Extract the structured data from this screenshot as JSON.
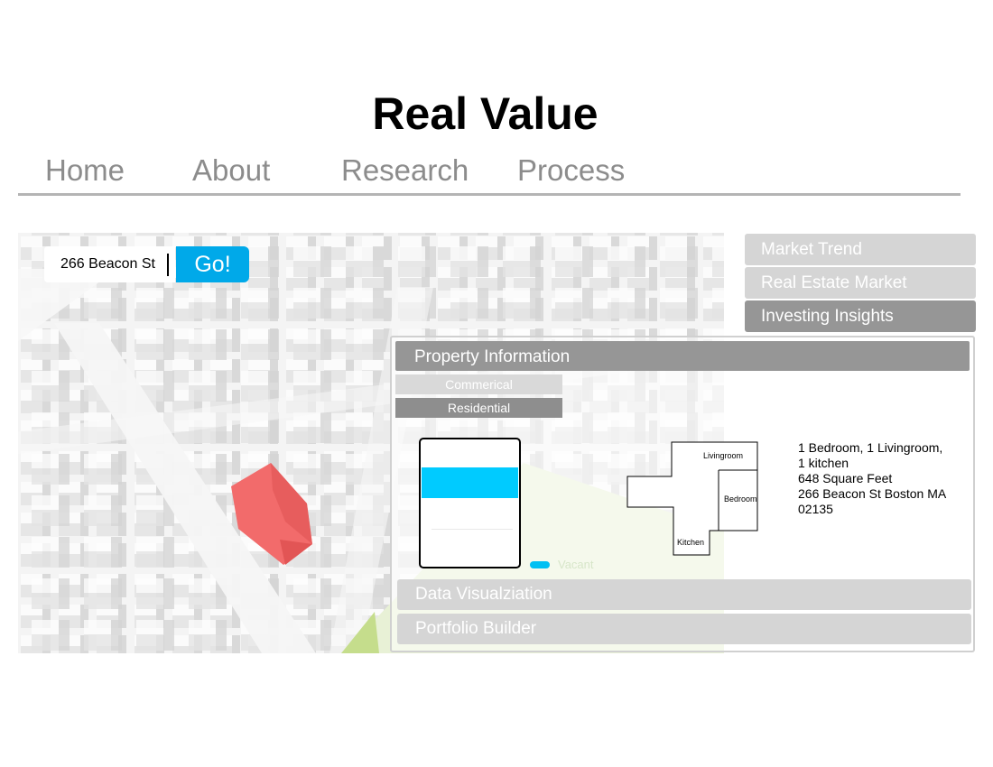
{
  "app": {
    "title": "Real Value"
  },
  "nav": {
    "items": [
      {
        "label": "Home"
      },
      {
        "label": "About"
      },
      {
        "label": "Research"
      },
      {
        "label": "Process"
      }
    ]
  },
  "search": {
    "value": "266 Beacon St",
    "button_label": "Go!"
  },
  "side_tabs": [
    {
      "label": "Market Trend",
      "active": false
    },
    {
      "label": "Real Estate Market",
      "active": false
    },
    {
      "label": "Investing Insights",
      "active": true
    }
  ],
  "property_panel": {
    "header": "Property Information",
    "subtabs": [
      {
        "label": "Commerical",
        "active": false
      },
      {
        "label": "Residential",
        "active": true
      }
    ],
    "legend": {
      "label": "Vacant",
      "color": "#00c0f3"
    },
    "floorplan": {
      "rooms": [
        "Livingroom",
        "Bedroom",
        "Kitchen"
      ]
    },
    "details": [
      "1 Bedroom, 1 Livingroom,",
      "1 kitchen",
      "648 Square Feet",
      "266 Beacon St Boston MA",
      "02135"
    ]
  },
  "bottom_sections": [
    {
      "label": "Data Visualziation"
    },
    {
      "label": "Portfolio Builder"
    }
  ],
  "colors": {
    "accent": "#00a9e9",
    "highlight_building": "#f26b6b",
    "active_tab": "#969696",
    "inactive_tab": "#d5d5d5",
    "park": "#c5dd8c"
  }
}
